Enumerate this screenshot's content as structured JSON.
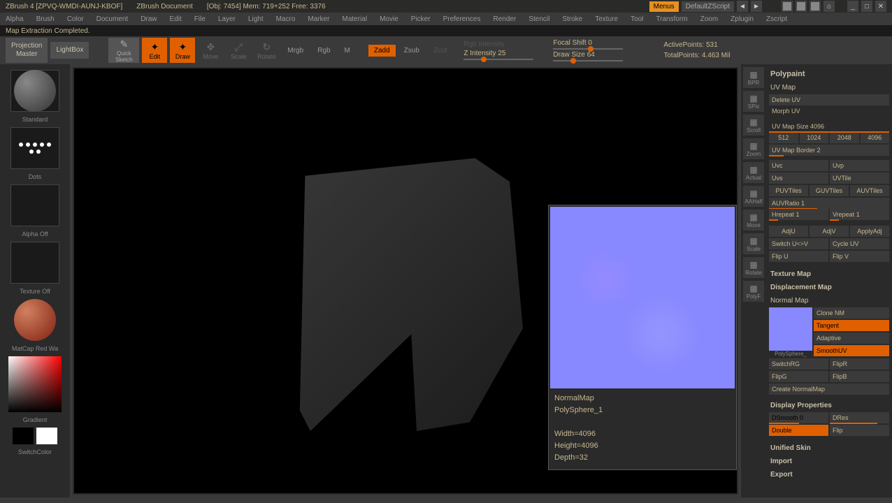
{
  "titlebar": {
    "app": "ZBrush 4 [ZPVQ-WMDI-AUNJ-KBOF]",
    "doc": "ZBrush Document",
    "info": "[Obj: 7454]  Mem: 719+252  Free: 3376",
    "menus": "Menus",
    "defaultscript": "DefaultZScript"
  },
  "menus": [
    "Alpha",
    "Brush",
    "Color",
    "Document",
    "Draw",
    "Edit",
    "File",
    "Layer",
    "Light",
    "Macro",
    "Marker",
    "Material",
    "Movie",
    "Picker",
    "Preferences",
    "Render",
    "Stencil",
    "Stroke",
    "Texture",
    "Tool",
    "Transform",
    "Zoom",
    "Zplugin",
    "Zscript"
  ],
  "status": "Map Extraction Completed.",
  "toolbar": {
    "projection": "Projection\nMaster",
    "lightbox": "LightBox",
    "quicksketch": "Quick\nSketch",
    "edit": "Edit",
    "draw": "Draw",
    "move": "Move",
    "scale": "Scale",
    "rotate": "Rotate",
    "mrgb": "Mrgb",
    "rgb": "Rgb",
    "m": "M",
    "rgbintensity": "Rgb Intensity",
    "zadd": "Zadd",
    "zsub": "Zsub",
    "zcut": "Zcut",
    "zintensity": "Z Intensity 25",
    "focalshift": "Focal Shift 0",
    "drawsize": "Draw Size 64",
    "activepoints": "ActivePoints: 531",
    "totalpoints": "TotalPoints: 4.463 Mil"
  },
  "leftpanel": {
    "standard": "Standard",
    "dots": "Dots",
    "alphaoff": "Alpha Off",
    "textureoff": "Texture Off",
    "matcap": "MatCap Red Wa",
    "gradient": "Gradient",
    "switchcolor": "SwitchColor"
  },
  "righttools": [
    "BPR",
    "SPix",
    "Scroll",
    "Zoom",
    "Actual",
    "AAHalf",
    "Move",
    "Scale",
    "Rotate",
    "PolyF"
  ],
  "preview": {
    "name": "NormalMap",
    "subtool": "PolySphere_1",
    "width": "Width=4096",
    "height": "Height=4096",
    "depth": "Depth=32"
  },
  "rightpanel": {
    "polypaint": "Polypaint",
    "uvmap": "UV Map",
    "deleteuv": "Delete UV",
    "morphuv": "Morph UV",
    "uvmapsize": "UV Map Size 4096",
    "sizes": [
      "512",
      "1024",
      "2048",
      "4096"
    ],
    "uvborder": "UV Map Border 2",
    "uvc": "Uvc",
    "uvp": "Uvp",
    "uvs": "Uvs",
    "uvtile": "UVTile",
    "puvtiles": "PUVTiles",
    "guvtiles": "GUVTiles",
    "auvtiles": "AUVTiles",
    "auvratio": "AUVRatio 1",
    "hrepeat": "Hrepeat 1",
    "vrepeat": "Vrepeat 1",
    "adju": "AdjU",
    "adjv": "AdjV",
    "applyadj": "ApplyAdj",
    "switchuv": "Switch U<>V",
    "cycleuv": "Cycle UV",
    "flipu": "Flip U",
    "flipv": "Flip V",
    "texturemap": "Texture Map",
    "displacement": "Displacement Map",
    "normalmap": "Normal Map",
    "clonenm": "Clone NM",
    "tangent": "Tangent",
    "adaptive": "Adaptive",
    "smoothuv": "SmoothUV",
    "polysphere": "PolySphere_",
    "switchrg": "SwitchRG",
    "flipr": "FlipR",
    "flipg": "FlipG",
    "flipb": "FlipB",
    "createnm": "Create NormalMap",
    "displayprops": "Display Properties",
    "dsmooth": "DSmooth 0",
    "dres": "DRes",
    "double": "Double",
    "flip": "Flip",
    "unifiedskin": "Unified Skin",
    "import": "Import",
    "export": "Export"
  }
}
